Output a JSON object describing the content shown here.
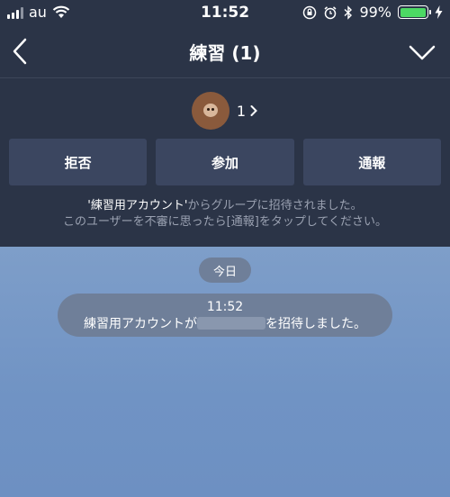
{
  "status_bar": {
    "carrier": "au",
    "time": "11:52",
    "battery_percent": "99%",
    "battery_level": 0.99,
    "icons": [
      "signal-icon",
      "wifi-icon",
      "rotation-lock-icon",
      "alarm-icon",
      "bluetooth-icon",
      "battery-icon",
      "charging-icon"
    ]
  },
  "header": {
    "title": "練習 (1)",
    "back_icon": "chevron-left-icon",
    "dropdown_icon": "chevron-down-icon"
  },
  "invite": {
    "member_count": "1",
    "buttons": {
      "reject": "拒否",
      "join": "参加",
      "report": "通報"
    },
    "notice_account": "'練習用アカウント'",
    "notice_line1_rest": "からグループに招待されました。",
    "notice_line2": "このユーザーを不審に思ったら[通報]をタップしてください。"
  },
  "chat": {
    "date_label": "今日",
    "system_message": {
      "time": "11:52",
      "text_before": "練習用アカウントが",
      "text_after": "を招待しました。"
    }
  },
  "colors": {
    "header_bg": "#2b3447",
    "button_bg": "#3b4660",
    "chat_bg": "#7093c4",
    "pill_bg": "#6f7f99",
    "battery": "#4cd964"
  }
}
